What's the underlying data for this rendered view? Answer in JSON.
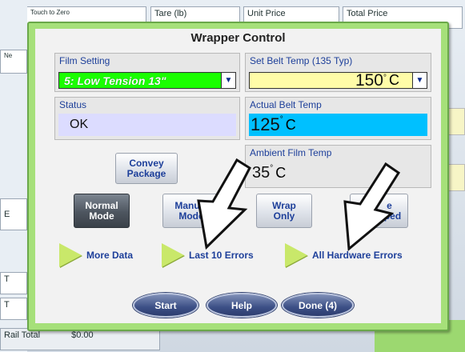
{
  "background": {
    "touch_to_zero": "Touch to Zero",
    "tare_label": "Tare (lb)",
    "unit_price_label": "Unit Price",
    "total_price_label": "Total Price",
    "left_fragment_ne": "Ne",
    "left_fragment_e": "E",
    "left_fragment_t1": "T",
    "left_fragment_t2": "T",
    "rail_total_label": "Rail Total",
    "rail_total_value": "$0.00"
  },
  "dialog": {
    "title": "Wrapper Control",
    "film_setting": {
      "label": "Film Setting",
      "value": "5: Low Tension 13\"",
      "value_color": "#1aff00"
    },
    "belt_temp_setting": {
      "label": "Set Belt Temp (135 Typ)",
      "value": "150",
      "unit": "C",
      "value_color": "#fffca8"
    },
    "status": {
      "label": "Status",
      "value": "OK",
      "value_color": "#dcdcff"
    },
    "actual_belt_temp": {
      "label": "Actual Belt Temp",
      "value": "125",
      "unit": "C",
      "value_color": "#00c0ff"
    },
    "ambient_film_temp": {
      "label": "Ambient Film Temp",
      "value": "35",
      "unit": "C"
    },
    "convey_button": {
      "line1": "Convey",
      "line2": "Package"
    },
    "mode_buttons": [
      {
        "line1": "Normal",
        "line2": "Mode"
      },
      {
        "line1": "Manual",
        "line2": "Mode"
      },
      {
        "line1": "Wrap",
        "line2": "Only"
      },
      {
        "line1": "e",
        "line2": "apped"
      }
    ],
    "links": {
      "more_data": "More Data",
      "last_errors": "Last 10 Errors",
      "hardware_errors": "All Hardware Errors"
    },
    "bottom_buttons": {
      "start": "Start",
      "help": "Help",
      "done": "Done (4)"
    }
  }
}
